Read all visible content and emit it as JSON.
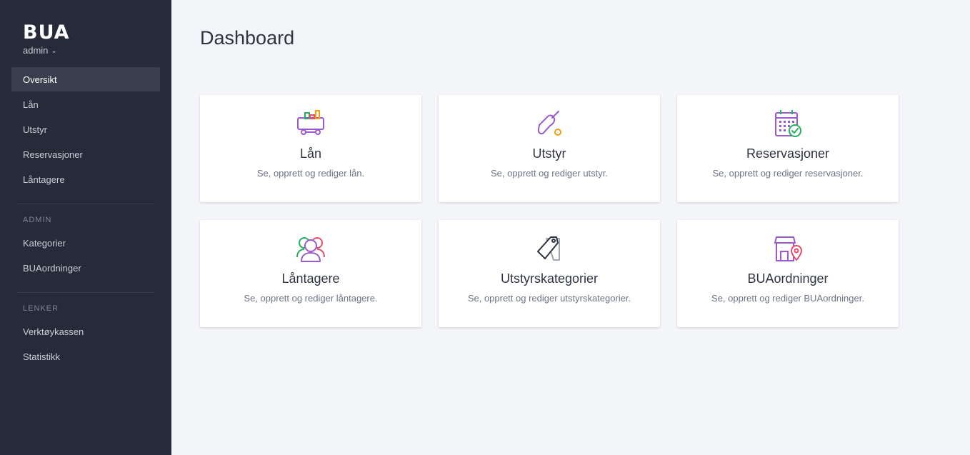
{
  "app": {
    "logo": "BUA",
    "user": "admin"
  },
  "sidebar": {
    "items": [
      {
        "label": "Oversikt"
      },
      {
        "label": "Lån"
      },
      {
        "label": "Utstyr"
      },
      {
        "label": "Reservasjoner"
      },
      {
        "label": "Låntagere"
      }
    ],
    "admin_title": "ADMIN",
    "admin_items": [
      {
        "label": "Kategorier"
      },
      {
        "label": "BUAordninger"
      }
    ],
    "links_title": "LENKER",
    "link_items": [
      {
        "label": "Verktøykassen"
      },
      {
        "label": "Statistikk"
      }
    ]
  },
  "main": {
    "title": "Dashboard",
    "cards": [
      {
        "title": "Lån",
        "description": "Se, opprett og rediger lån.",
        "icon": "cart-icon"
      },
      {
        "title": "Utstyr",
        "description": "Se, opprett og rediger utstyr.",
        "icon": "paddle-icon"
      },
      {
        "title": "Reservasjoner",
        "description": "Se, opprett og rediger reservasjoner.",
        "icon": "calendar-check-icon"
      },
      {
        "title": "Låntagere",
        "description": "Se, opprett og rediger låntagere.",
        "icon": "users-icon"
      },
      {
        "title": "Utstyrskategorier",
        "description": "Se, opprett og rediger utstyrskategorier.",
        "icon": "tags-icon"
      },
      {
        "title": "BUAordninger",
        "description": "Se, opprett og rediger BUAordninger.",
        "icon": "store-location-icon"
      }
    ]
  },
  "colors": {
    "sidebar_bg": "#262b3a",
    "active_bg": "#3a3f4f",
    "page_bg": "#f4f5f9",
    "accent_purple": "#9b59d0",
    "accent_orange": "#f39c12",
    "accent_green": "#27ae60",
    "accent_red": "#e74c6c"
  }
}
